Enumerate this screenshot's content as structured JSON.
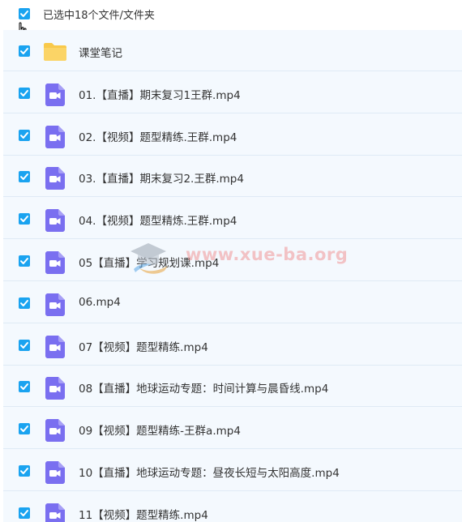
{
  "header": {
    "selection_label": "已选中18个文件/文件夹",
    "select_all_checked": true
  },
  "items": [
    {
      "name": "课堂笔记",
      "type": "folder",
      "checked": true
    },
    {
      "name": "01.【直播】期末复习1王群.mp4",
      "type": "video",
      "checked": true
    },
    {
      "name": "02.【视频】题型精练.王群.mp4",
      "type": "video",
      "checked": true
    },
    {
      "name": "03.【直播】期末复习2.王群.mp4",
      "type": "video",
      "checked": true
    },
    {
      "name": "04.【视频】题型精炼.王群.mp4",
      "type": "video",
      "checked": true
    },
    {
      "name": "05【直播】学习规划课.mp4",
      "type": "video",
      "checked": true
    },
    {
      "name": "06.mp4",
      "type": "video",
      "checked": true
    },
    {
      "name": "07【视频】题型精练.mp4",
      "type": "video",
      "checked": true
    },
    {
      "name": "08【直播】地球运动专题：时间计算与晨昏线.mp4",
      "type": "video",
      "checked": true
    },
    {
      "name": "09【视频】题型精练-王群a.mp4",
      "type": "video",
      "checked": true
    },
    {
      "name": "10【直播】地球运动专题：昼夜长短与太阳高度.mp4",
      "type": "video",
      "checked": true
    },
    {
      "name": "11【视频】题型精练.mp4",
      "type": "video",
      "checked": true
    }
  ],
  "watermark": {
    "text": "www.xue-ba.org"
  },
  "colors": {
    "checkbox": "#1aa3f0",
    "video_icon": "#7a6ff0",
    "folder_icon": "#f9c94a",
    "list_bg": "#f4f9fe",
    "row_border": "#dfeaf5"
  }
}
